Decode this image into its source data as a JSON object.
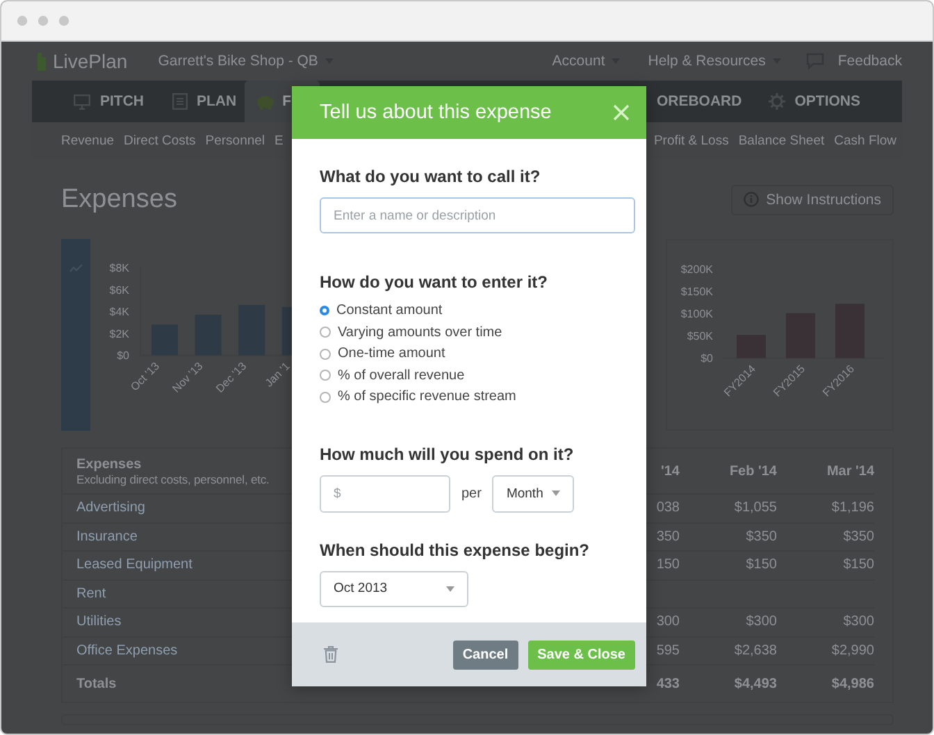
{
  "topbar": {
    "logo": "LivePlan",
    "business": "Garrett's Bike Shop - QB",
    "menus": [
      "Account",
      "Help & Resources"
    ],
    "feedback": "Feedback"
  },
  "nav_tabs": [
    {
      "label": "PITCH",
      "selected": false
    },
    {
      "label": "PLAN",
      "selected": false
    },
    {
      "label": "F",
      "selected": true
    },
    {
      "label": "OREBOARD",
      "selected": false
    },
    {
      "label": "OPTIONS",
      "selected": false
    }
  ],
  "subnav_left": [
    "Revenue",
    "Direct Costs",
    "Personnel",
    "E"
  ],
  "subnav_right": [
    "Profit & Loss",
    "Balance Sheet",
    "Cash Flow"
  ],
  "page": {
    "title": "Expenses",
    "instructions_button": "Show Instructions"
  },
  "monthly_chart": {
    "chart_data": {
      "type": "bar",
      "categories": [
        "Oct '13",
        "Nov '13",
        "Dec '13",
        "Jan '1"
      ],
      "values": [
        2800,
        3700,
        4600,
        4400
      ],
      "ylim": [
        0,
        8000
      ],
      "yticks": [
        {
          "value": 0,
          "label": "$0"
        },
        {
          "value": 2000,
          "label": "$2K"
        },
        {
          "value": 4000,
          "label": "$4K"
        },
        {
          "value": 6000,
          "label": "$6K"
        },
        {
          "value": 8000,
          "label": "$8K"
        }
      ]
    }
  },
  "yearly_chart": {
    "chart_data": {
      "type": "bar",
      "categories": [
        "FY2014",
        "FY2015",
        "FY2016"
      ],
      "values": [
        52000,
        101000,
        122000
      ],
      "ylim": [
        0,
        200000
      ],
      "yticks": [
        {
          "value": 0,
          "label": "$0"
        },
        {
          "value": 50000,
          "label": "$50K"
        },
        {
          "value": 100000,
          "label": "$100K"
        },
        {
          "value": 150000,
          "label": "$150K"
        },
        {
          "value": 200000,
          "label": "$200K"
        }
      ]
    }
  },
  "table": {
    "title": "Expenses",
    "subtitle": "Excluding direct costs, personnel, etc.",
    "columns": [
      "'14",
      "Feb '14",
      "Mar '14"
    ],
    "rows": [
      {
        "label": "Advertising",
        "kind": "item",
        "values": [
          "038",
          "$1,055",
          "$1,196"
        ]
      },
      {
        "label": "Insurance",
        "kind": "item",
        "values": [
          "350",
          "$350",
          "$350"
        ]
      },
      {
        "label": "Leased Equipment",
        "kind": "item",
        "values": [
          "150",
          "$150",
          "$150"
        ]
      },
      {
        "label": "Rent",
        "kind": "item"
      },
      {
        "label": "Utilities",
        "kind": "item",
        "values": [
          "300",
          "$300",
          "$300"
        ]
      },
      {
        "label": "Office Expenses",
        "kind": "item",
        "values": [
          "595",
          "$2,638",
          "$2,990"
        ]
      },
      {
        "label": "Totals",
        "kind": "total",
        "values": [
          "433",
          "$4,493",
          "$4,986"
        ]
      }
    ]
  },
  "modal": {
    "title": "Tell us about this expense",
    "name_question": "What do you want to call it?",
    "name_placeholder": "Enter a name or description",
    "method_question": "How do you want to enter it?",
    "methods": [
      {
        "label": "Constant amount",
        "selected": true
      },
      {
        "label": "Varying amounts over time",
        "selected": false
      },
      {
        "label": "One-time amount",
        "selected": false
      },
      {
        "label": "% of overall revenue",
        "selected": false
      },
      {
        "label": "% of specific revenue stream",
        "selected": false
      }
    ],
    "amount_question": "How much will you spend on it?",
    "amount_placeholder": "$",
    "per_label": "per",
    "period": "Month",
    "start_question": "When should this expense begin?",
    "start": "Oct 2013",
    "cancel_button": "Cancel",
    "save_button": "Save & Close"
  }
}
